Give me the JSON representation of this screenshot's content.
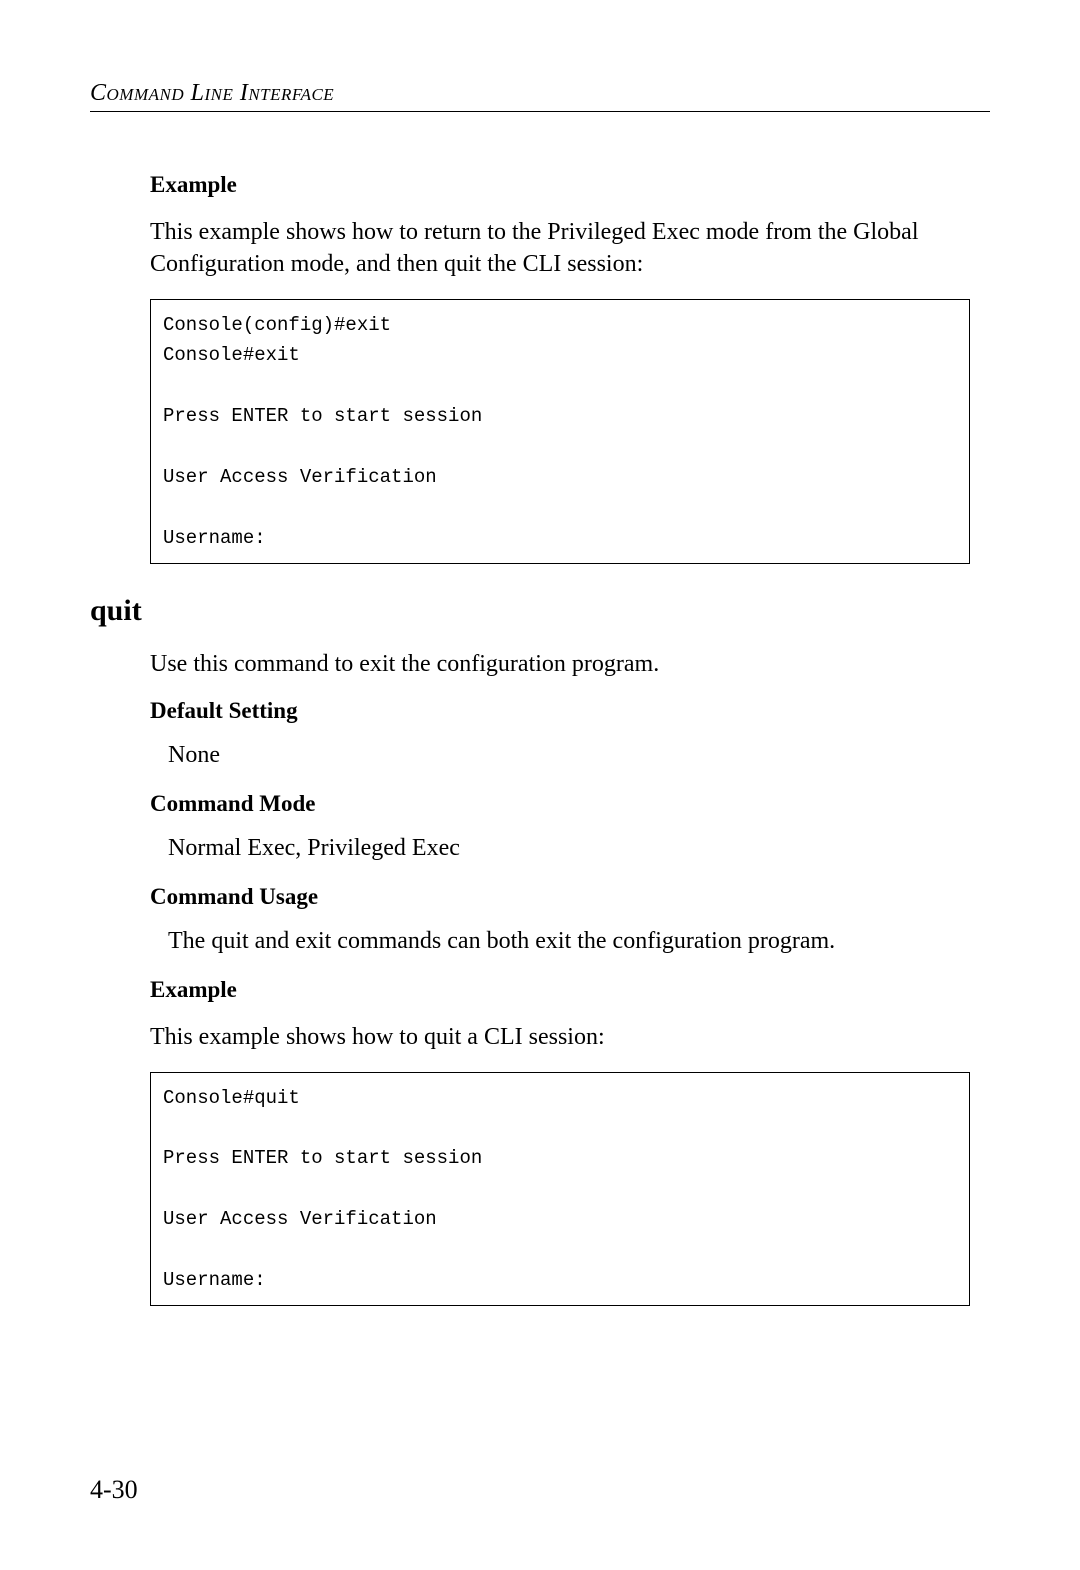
{
  "header": "Command Line Interface",
  "example1": {
    "heading": "Example",
    "text": "This example shows how to return to the Privileged Exec mode from the Global Configuration mode, and then quit the CLI session:",
    "code": "Console(config)#exit\nConsole#exit\n\nPress ENTER to start session\n\nUser Access Verification\n\nUsername:"
  },
  "quit": {
    "heading": "quit",
    "description": "Use this command to exit the configuration program.",
    "defaultSetting": {
      "heading": "Default Setting",
      "value": "None"
    },
    "commandMode": {
      "heading": "Command Mode",
      "value": "Normal Exec, Privileged Exec"
    },
    "commandUsage": {
      "heading": "Command Usage",
      "value": "The quit and exit commands can both exit the configuration program."
    },
    "example": {
      "heading": "Example",
      "text": "This example shows how to quit a CLI session:",
      "code": "Console#quit\n\nPress ENTER to start session\n\nUser Access Verification\n\nUsername:"
    }
  },
  "pageNumber": "4-30"
}
